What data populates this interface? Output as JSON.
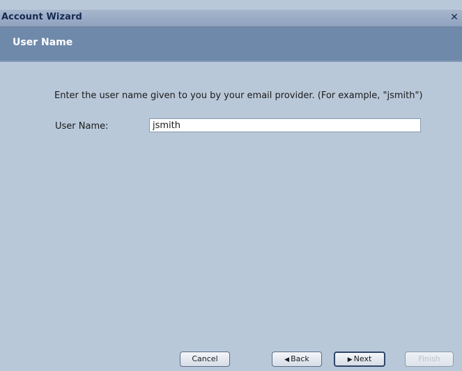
{
  "window": {
    "title": "Account Wizard",
    "close_icon": "close-icon"
  },
  "header": {
    "title": "User Name"
  },
  "content": {
    "instruction": "Enter the user name given to you by your email provider.  (For example, \"jsmith\")",
    "username_label": "User Name:",
    "username_value": "jsmith"
  },
  "buttons": {
    "cancel": "Cancel",
    "back": "Back",
    "next": "Next",
    "finish": "Finish"
  },
  "colors": {
    "window_bg": "#b9c8d9",
    "header_band": "#6f89aa",
    "title_text": "#152a52"
  }
}
